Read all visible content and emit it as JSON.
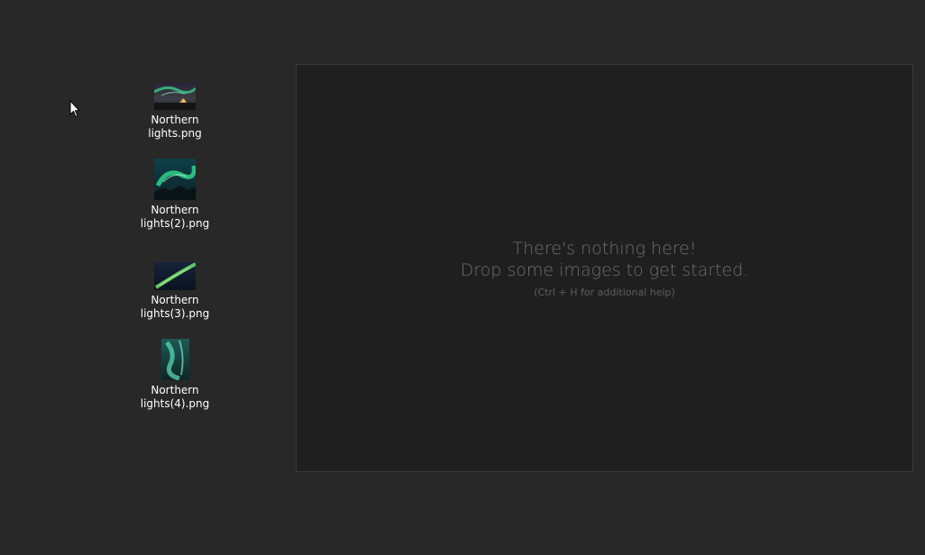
{
  "files": [
    {
      "line1": "Northern",
      "line2": "lights.png",
      "icon": "image-thumbnail-icon"
    },
    {
      "line1": "Northern",
      "line2": "lights(2).png",
      "icon": "image-thumbnail-icon"
    },
    {
      "line1": "Northern",
      "line2": "lights(3).png",
      "icon": "image-thumbnail-icon"
    },
    {
      "line1": "Northern",
      "line2": "lights(4).png",
      "icon": "image-thumbnail-icon"
    }
  ],
  "drop_zone": {
    "title_line1": "There's nothing here!",
    "title_line2": "Drop some images to get started.",
    "help_text": "(Ctrl + H for additional help)"
  },
  "colors": {
    "background": "#282828",
    "panel": "#1f1f1f",
    "aurora_green": "#2fd38a"
  },
  "cursor": {
    "icon": "arrow-cursor-icon"
  }
}
